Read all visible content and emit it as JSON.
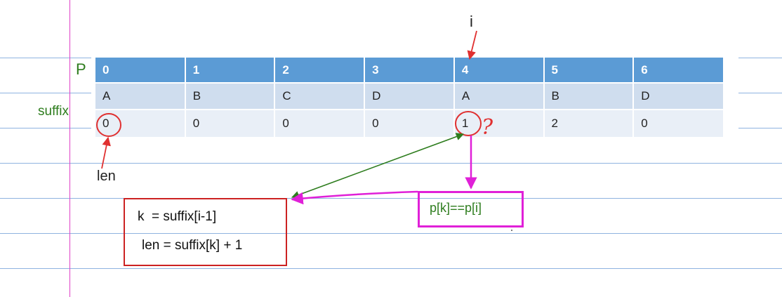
{
  "table": {
    "row_label_p": "P",
    "row_label_suffix": "suffix",
    "header": [
      "0",
      "1",
      "2",
      "3",
      "4",
      "5",
      "6"
    ],
    "chars": [
      "A",
      "B",
      "C",
      "D",
      "A",
      "B",
      "D"
    ],
    "suffix": [
      "0",
      "0",
      "0",
      "0",
      "1",
      "2",
      "0"
    ]
  },
  "annotations": {
    "i_label": "i",
    "len_label": "len",
    "question_mark": "?",
    "compare_text": "p[k]==p[i]",
    "formula_line1": "k  = suffix[i-1]",
    "formula_line2": "len = suffix[k] + 1"
  },
  "colors": {
    "header_blue": "#5b9bd5",
    "annotation_red": "#e03030",
    "annotation_green": "#2e7d1e",
    "annotation_magenta": "#e020d8",
    "formula_box_red": "#cc2222"
  }
}
